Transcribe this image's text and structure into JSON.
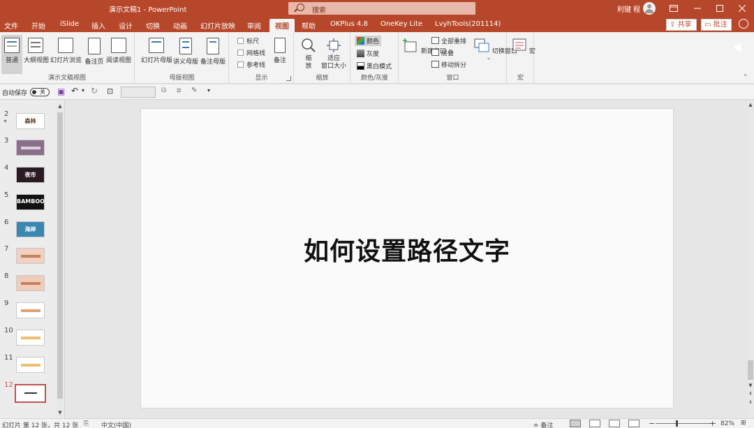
{
  "app": {
    "title": "演示文稿1  -  PowerPoint",
    "search_placeholder": "搜索",
    "user": "利键 程",
    "accent": "#b7472a"
  },
  "tabs": [
    "文件",
    "开始",
    "iSlide",
    "插入",
    "设计",
    "切换",
    "动画",
    "幻灯片放映",
    "审阅",
    "视图",
    "帮助",
    "OKPlus 4.8",
    "OneKey Lite",
    "LvyhTools(201114)"
  ],
  "tab_share": "共享",
  "tab_comment": "批注",
  "ribbon": {
    "presentation_views": {
      "label": "演示文稿视图",
      "normal": "普通",
      "outline": "大纲视图",
      "sorter": "幻灯片浏览",
      "notes": "备注页",
      "reading": "阅读视图"
    },
    "master_views": {
      "label": "母版视图",
      "slide_master": "幻灯片母版",
      "handout_master": "讲义母版",
      "notes_master": "备注母版"
    },
    "show": {
      "label": "显示",
      "ruler": "标尺",
      "gridlines": "网格线",
      "guides": "参考线",
      "notes": "备注"
    },
    "zoom": {
      "label": "缩放",
      "zoom": "缩\n放",
      "fit_l1": "适应",
      "fit_l2": "窗口大小"
    },
    "color": {
      "label": "颜色/灰度",
      "color": "颜色",
      "gray": "灰度",
      "bw": "黑白模式"
    },
    "window": {
      "label": "窗口",
      "new_window": "新建窗口",
      "arrange_all": "全部重排",
      "cascade": "层叠",
      "move_split": "移动拆分",
      "switch": "切换窗口"
    },
    "macro": {
      "label": "宏",
      "macros": "宏"
    }
  },
  "qat": {
    "autosave_label": "自动保存",
    "toggle_state": "关"
  },
  "slides": [
    {
      "num": "2",
      "label": "森林",
      "bg": "#ffffff",
      "fg": "#5a3a1a",
      "star": true
    },
    {
      "num": "3",
      "label": "",
      "bg": "#8a6f8d",
      "fg": "#fff"
    },
    {
      "num": "4",
      "label": "夜市",
      "bg": "#2a1a22",
      "fg": "#ffffff"
    },
    {
      "num": "5",
      "label": "BAMBOO",
      "bg": "#111111",
      "fg": "#ffffff"
    },
    {
      "num": "6",
      "label": "海岸",
      "bg": "#3a87b0",
      "fg": "#ffffff"
    },
    {
      "num": "7",
      "label": "",
      "bg": "#f1d1bd",
      "fg": "#b0603a"
    },
    {
      "num": "8",
      "label": "",
      "bg": "#efcdb8",
      "fg": "#b0603a"
    },
    {
      "num": "9",
      "label": "",
      "bg": "#ffffff",
      "fg": "#d07a3a"
    },
    {
      "num": "10",
      "label": "",
      "bg": "#ffffff",
      "fg": "#e5a33a"
    },
    {
      "num": "11",
      "label": "",
      "bg": "#ffffff",
      "fg": "#e5a33a"
    },
    {
      "num": "12",
      "label": "",
      "bg": "#ffffff",
      "fg": "#333",
      "active": true
    }
  ],
  "slide": {
    "title": "如何设置路径文字"
  },
  "status": {
    "slide_info": "幻灯片 第 12 张，共 12 张",
    "language": "中文(中国)",
    "notes": "备注",
    "zoom": "82%"
  }
}
